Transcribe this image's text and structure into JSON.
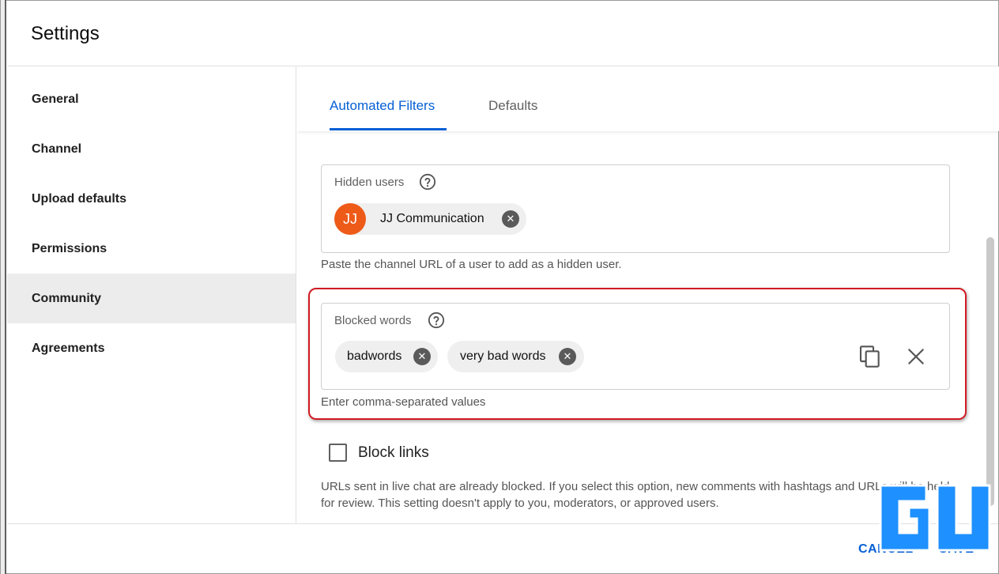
{
  "header": {
    "title": "Settings"
  },
  "sidebar": {
    "items": [
      {
        "label": "General"
      },
      {
        "label": "Channel"
      },
      {
        "label": "Upload defaults"
      },
      {
        "label": "Permissions"
      },
      {
        "label": "Community",
        "active": true
      },
      {
        "label": "Agreements"
      }
    ]
  },
  "tabs": [
    {
      "label": "Automated Filters",
      "active": true
    },
    {
      "label": "Defaults"
    }
  ],
  "hidden_users": {
    "label": "Hidden users",
    "chips": [
      {
        "avatar_text": "JJ",
        "label": "JJ Communication"
      }
    ],
    "helper": "Paste the channel URL of a user to add as a hidden user."
  },
  "blocked_words": {
    "label": "Blocked words",
    "chips": [
      {
        "label": "badwords"
      },
      {
        "label": "very bad words"
      }
    ],
    "helper": "Enter comma-separated values"
  },
  "block_links": {
    "label": "Block links",
    "checked": false,
    "description": "URLs sent in live chat are already blocked. If you select this option, new comments with hashtags and URLs will be held for review. This setting doesn't apply to you, moderators, or approved users."
  },
  "footer": {
    "cancel_label": "CANCEL",
    "save_label": "SAVE"
  },
  "watermark": {
    "text": "GADGETS TO USE"
  },
  "colors": {
    "accent": "#065fd4",
    "highlight": "#d01a22",
    "avatar": "#ee5a18",
    "brand_blue": "#1e90ff"
  }
}
